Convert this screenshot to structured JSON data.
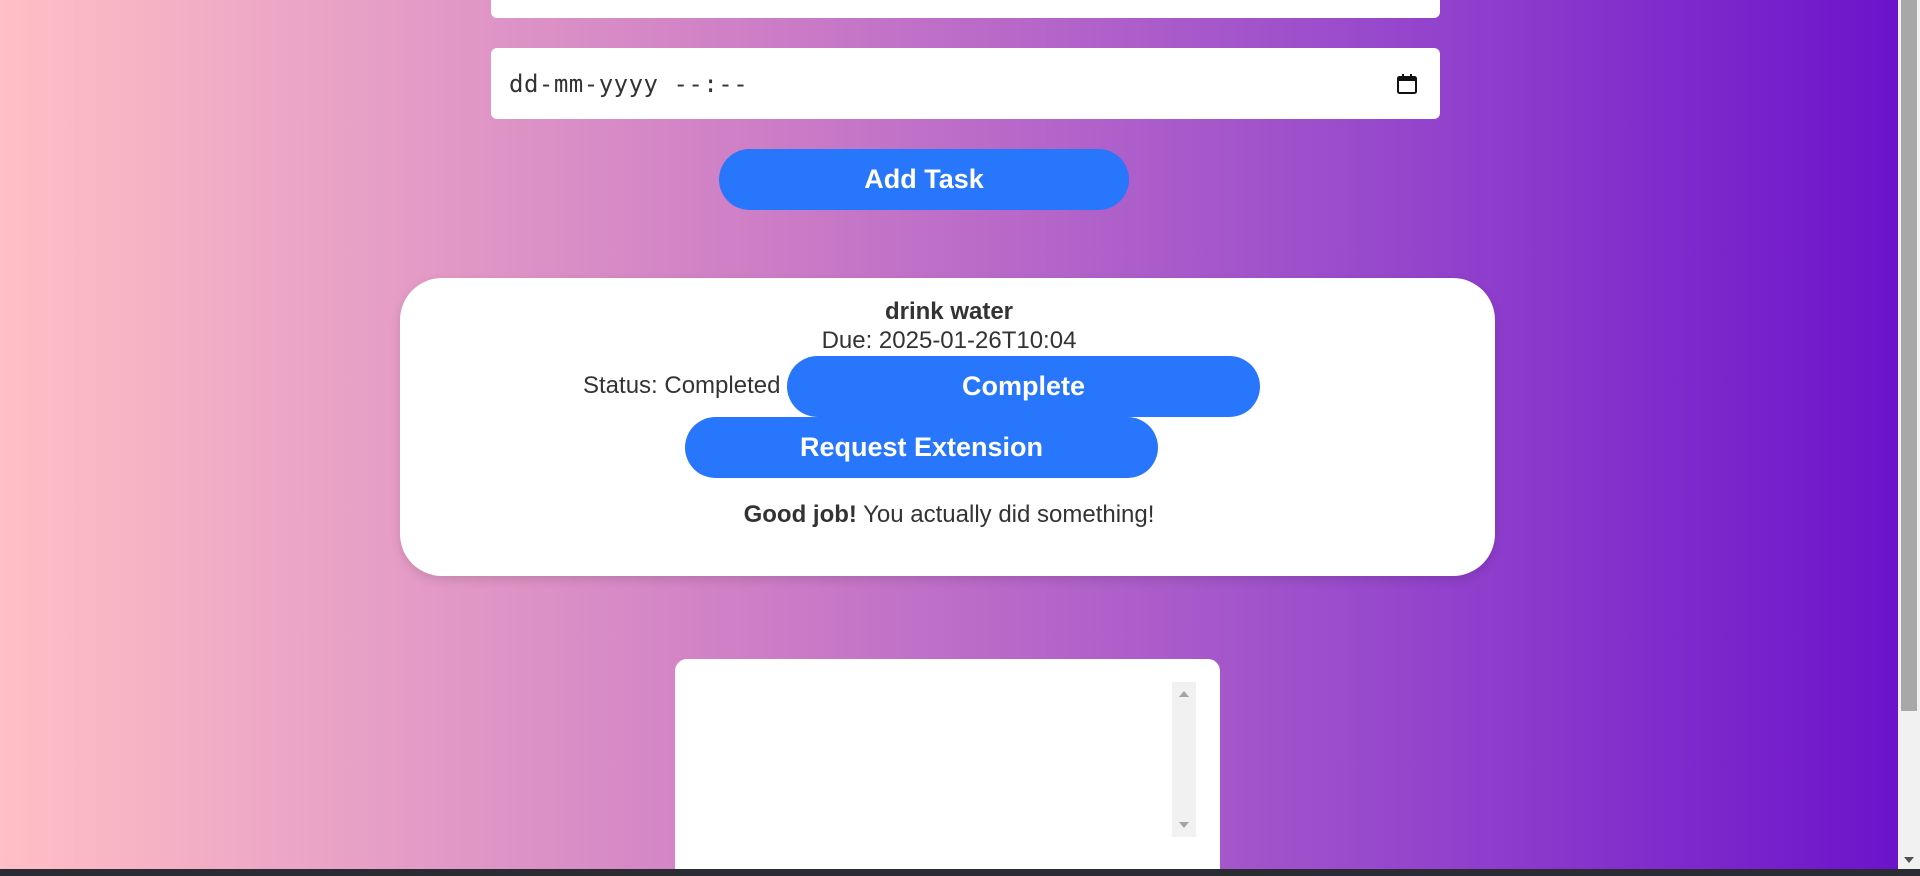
{
  "form": {
    "due_date_placeholder": "dd-mm-yyyy --:--",
    "add_task_label": "Add Task"
  },
  "task": {
    "title": "drink water",
    "due": "Due: 2025-01-26T10:04",
    "status": "Status: Completed",
    "complete_label": "Complete",
    "extension_label": "Request Extension",
    "message_strong": "Good job!",
    "message_rest": " You actually did something!"
  },
  "colors": {
    "accent": "#2776fb",
    "gradient_start": "#ffbfc5",
    "gradient_end": "#6a11cb"
  },
  "icons": {
    "date_picker": "calendar-icon"
  }
}
